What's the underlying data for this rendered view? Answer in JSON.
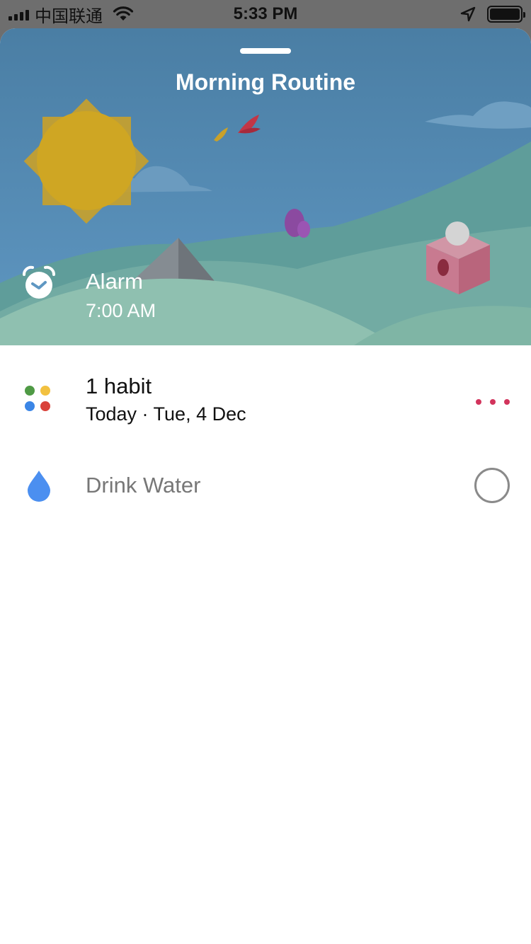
{
  "status_bar": {
    "carrier": "中国联通",
    "time": "5:33 PM"
  },
  "routine": {
    "title": "Morning Routine",
    "alarm_label": "Alarm",
    "alarm_time": "7:00 AM"
  },
  "habits_summary": {
    "count_label": "1 habit",
    "date_label": "Today · Tue, 4 Dec",
    "dot_colors": [
      "#4f9a45",
      "#f2c140",
      "#3b86e6",
      "#d9423a"
    ]
  },
  "habits": [
    {
      "name": "Drink Water",
      "icon": "water-drop-icon",
      "completed": false
    }
  ],
  "colors": {
    "accent_more": "#d2345c",
    "drop": "#4b8ff0"
  }
}
